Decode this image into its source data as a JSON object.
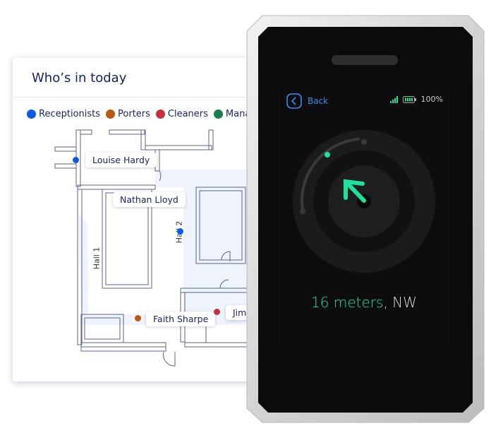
{
  "card": {
    "title": "Who’s in today",
    "legend": [
      {
        "label": "Receptionists",
        "color": "#0a5ce8"
      },
      {
        "label": "Porters",
        "color": "#b85a10"
      },
      {
        "label": "Cleaners",
        "color": "#c9303e"
      },
      {
        "label": "Managers",
        "color": "#17804f"
      }
    ],
    "people": [
      {
        "name": "Louise Hardy",
        "color": "#0a5ce8"
      },
      {
        "name": "Nathan Lloyd"
      },
      {
        "name": "Faith Sharpe",
        "color": "#b85a10"
      },
      {
        "name": "Jim",
        "color": "#c9303e"
      }
    ],
    "halls": [
      "Hall 1",
      "Hall 2"
    ],
    "hall2_dot_color": "#0a5ce8"
  },
  "device": {
    "back_label": "Back",
    "battery": "100%",
    "distance": "16 meters",
    "direction": ", NW",
    "accent": "#1de39a",
    "back_color": "#3d8cf0",
    "heading": "NW"
  }
}
